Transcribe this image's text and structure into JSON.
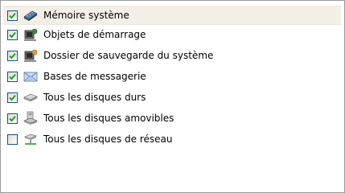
{
  "items": [
    {
      "label": "Mémoire système",
      "checked": true,
      "icon": "memory-chip-icon",
      "selected": true
    },
    {
      "label": "Objets de démarrage",
      "checked": true,
      "icon": "startup-objects-icon",
      "selected": false
    },
    {
      "label": "Dossier de sauvegarde du système",
      "checked": true,
      "icon": "system-restore-folder-icon",
      "selected": false
    },
    {
      "label": "Bases de messagerie",
      "checked": true,
      "icon": "mail-envelope-icon",
      "selected": false
    },
    {
      "label": "Tous les disques durs",
      "checked": true,
      "icon": "hard-disk-icon",
      "selected": false
    },
    {
      "label": "Tous les disques amovibles",
      "checked": true,
      "icon": "removable-disk-icon",
      "selected": false
    },
    {
      "label": "Tous les disques de réseau",
      "checked": false,
      "icon": "network-drive-icon",
      "selected": false
    }
  ],
  "colors": {
    "check": "#21a121",
    "selected_bg": "#f3efe7",
    "border": "#9a9a9a"
  }
}
